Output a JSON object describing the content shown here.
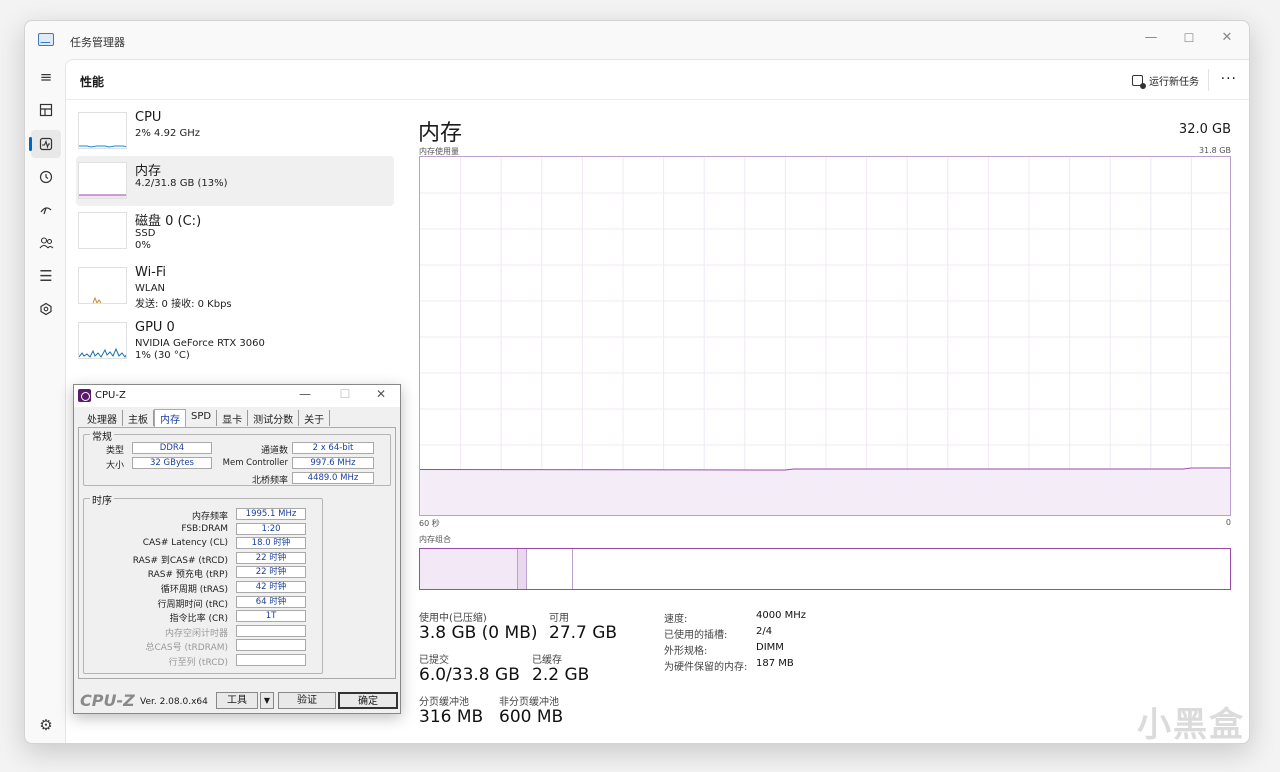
{
  "window": {
    "title": "任务管理器"
  },
  "header": {
    "title": "性能",
    "run_task": "运行新任务",
    "more": "···"
  },
  "devices": [
    {
      "name": "CPU",
      "line1": "2% 4.92 GHz",
      "line2": ""
    },
    {
      "name": "内存",
      "line1": "4.2/31.8 GB (13%)",
      "line2": ""
    },
    {
      "name": "磁盘 0 (C:)",
      "line1": "SSD",
      "line2": "0%"
    },
    {
      "name": "Wi-Fi",
      "line1": "WLAN",
      "line2": "发送: 0 接收: 0 Kbps"
    },
    {
      "name": "GPU 0",
      "line1": "NVIDIA GeForce RTX 3060",
      "line2": "1% (30 °C)"
    }
  ],
  "memory": {
    "title": "内存",
    "total": "32.0 GB",
    "usage_label": "内存使用量",
    "usage_max": "31.8 GB",
    "time_left": "60 秒",
    "time_right": "0",
    "composition_label": "内存组合",
    "usage_fraction": 0.132,
    "stats": {
      "in_use_label": "使用中(已压缩)",
      "in_use_value": "3.8 GB (0 MB)",
      "available_label": "可用",
      "available_value": "27.7 GB",
      "committed_label": "已提交",
      "committed_value": "6.0/33.8 GB",
      "cached_label": "已缓存",
      "cached_value": "2.2 GB",
      "paged_label": "分页缓冲池",
      "paged_value": "316 MB",
      "nonpaged_label": "非分页缓冲池",
      "nonpaged_value": "600 MB"
    },
    "side": {
      "speed_label": "速度:",
      "speed_value": "4000 MHz",
      "slots_label": "已使用的插槽:",
      "slots_value": "2/4",
      "form_label": "外形规格:",
      "form_value": "DIMM",
      "reserved_label": "为硬件保留的内存:",
      "reserved_value": "187 MB"
    }
  },
  "cpuz": {
    "title": "CPU-Z",
    "tabs": [
      "处理器",
      "主板",
      "内存",
      "SPD",
      "显卡",
      "测试分数",
      "关于"
    ],
    "general_label": "常规",
    "type_label": "类型",
    "type_value": "DDR4",
    "size_label": "大小",
    "size_value": "32 GBytes",
    "channels_label": "通道数",
    "channels_value": "2 x 64-bit",
    "memctrl_label": "Mem Controller",
    "memctrl_value": "997.6 MHz",
    "nb_label": "北桥频率",
    "nb_value": "4489.0 MHz",
    "timing_label": "时序",
    "timings": [
      {
        "label": "内存频率",
        "value": "1995.1 MHz",
        "dim": false
      },
      {
        "label": "FSB:DRAM",
        "value": "1:20",
        "dim": false
      },
      {
        "label": "CAS# Latency (CL)",
        "value": "18.0 时钟",
        "dim": false
      },
      {
        "label": "RAS# 到CAS# (tRCD)",
        "value": "22 时钟",
        "dim": false
      },
      {
        "label": "RAS# 预充电 (tRP)",
        "value": "22 时钟",
        "dim": false
      },
      {
        "label": "循环周期 (tRAS)",
        "value": "42 时钟",
        "dim": false
      },
      {
        "label": "行周期时间 (tRC)",
        "value": "64 时钟",
        "dim": false
      },
      {
        "label": "指令比率 (CR)",
        "value": "1T",
        "dim": false
      },
      {
        "label": "内存空闲计时器",
        "value": "",
        "dim": true
      },
      {
        "label": "总CAS号 (tRDRAM)",
        "value": "",
        "dim": true
      },
      {
        "label": "行至列 (tRCD)",
        "value": "",
        "dim": true
      }
    ],
    "logo": "CPU-Z",
    "version": "Ver. 2.08.0.x64",
    "tools_label": "工具",
    "validate_label": "验证",
    "ok_label": "确定"
  },
  "watermark": "小黑盒"
}
